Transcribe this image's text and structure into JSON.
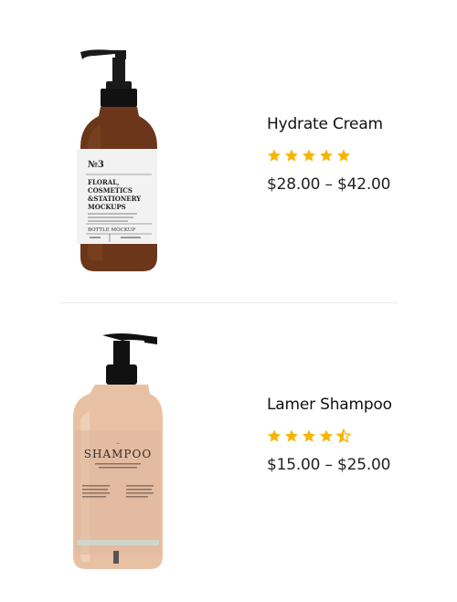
{
  "products": [
    {
      "name": "Hydrate Cream",
      "rating": 5,
      "price": "$28.00 – $42.00",
      "image_label": {
        "number": "№3",
        "line1": "FLORAL,",
        "line2": "COSMETICS",
        "line3": "&STATIONERY",
        "line4": "MOCKUPS",
        "footer": "BOTTLE MOCKUP"
      }
    },
    {
      "name": "Lamer Shampoo",
      "rating": 4.5,
      "price": "$15.00 – $25.00",
      "image_label": {
        "title": "SHAMPOO"
      }
    }
  ],
  "colors": {
    "star": "#f7b500",
    "divider": "#ececec",
    "amber_bottle": "#6b3619",
    "peach_bottle": "#e8c1a5"
  },
  "icons": [
    "star-icon",
    "half-star-icon"
  ]
}
